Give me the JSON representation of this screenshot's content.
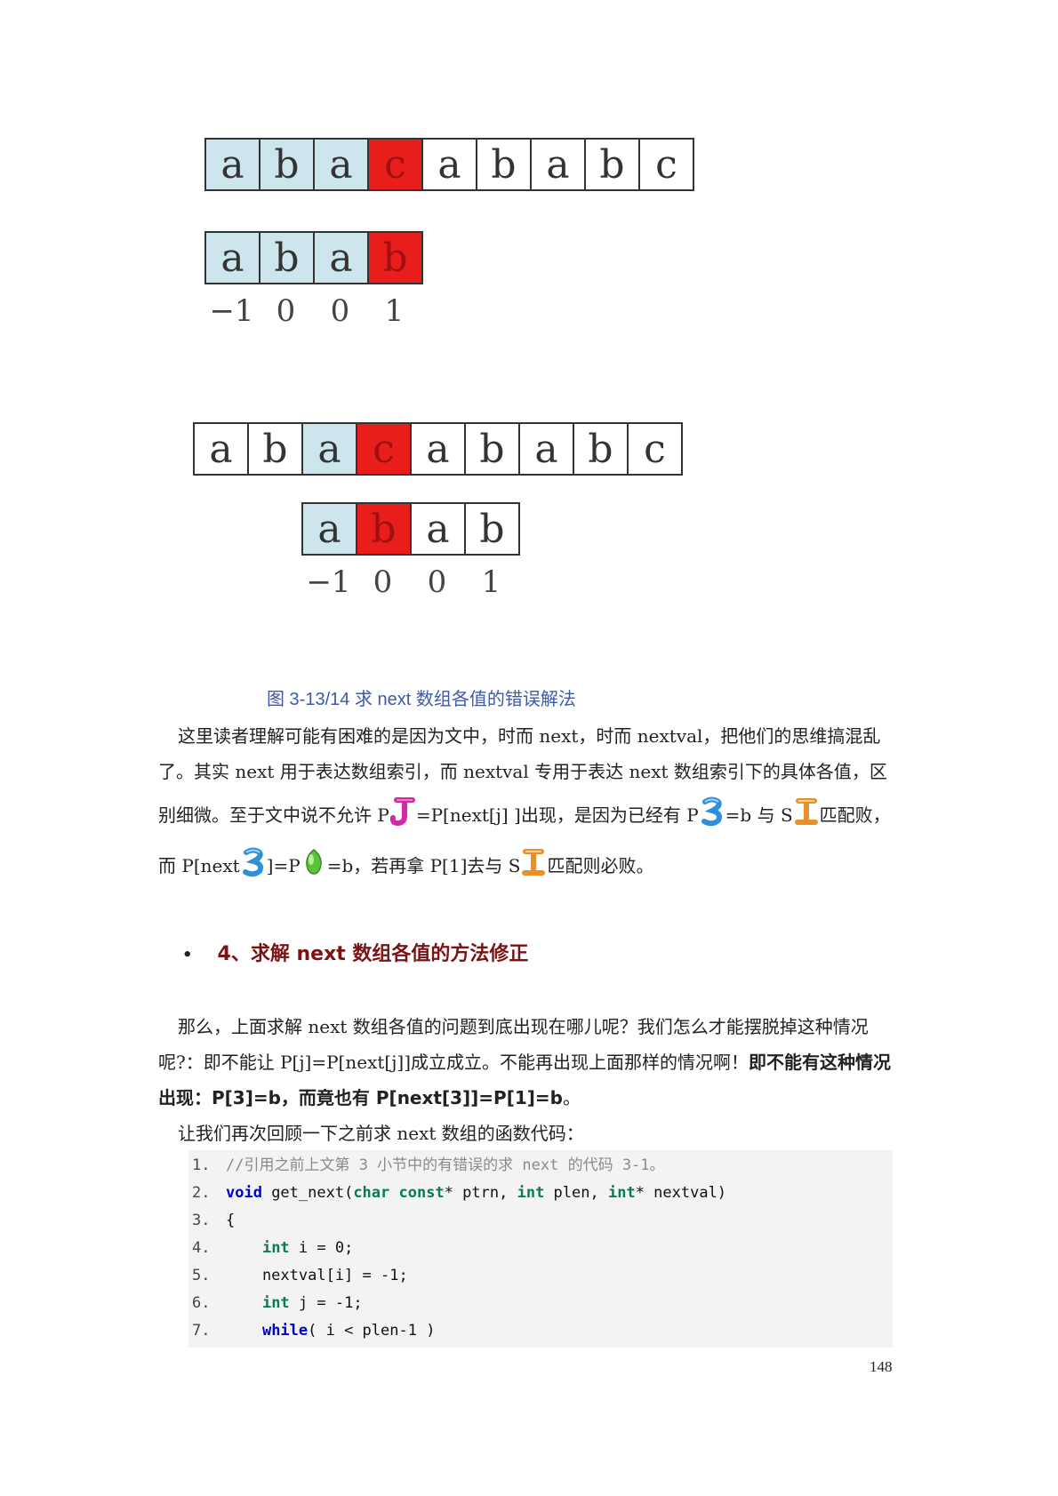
{
  "diagram1": {
    "text_cells": [
      {
        "ch": "a",
        "fill": "blue"
      },
      {
        "ch": "b",
        "fill": "blue"
      },
      {
        "ch": "a",
        "fill": "blue"
      },
      {
        "ch": "c",
        "fill": "red"
      },
      {
        "ch": "a",
        "fill": "white"
      },
      {
        "ch": "b",
        "fill": "white"
      },
      {
        "ch": "a",
        "fill": "white"
      },
      {
        "ch": "b",
        "fill": "white"
      },
      {
        "ch": "c",
        "fill": "white"
      }
    ],
    "pattern_cells": [
      {
        "ch": "a",
        "fill": "blue"
      },
      {
        "ch": "b",
        "fill": "blue"
      },
      {
        "ch": "a",
        "fill": "blue"
      },
      {
        "ch": "b",
        "fill": "red"
      }
    ],
    "next_values": [
      "−1",
      "0",
      "0",
      "1"
    ]
  },
  "diagram2": {
    "text_cells": [
      {
        "ch": "a",
        "fill": "white"
      },
      {
        "ch": "b",
        "fill": "white"
      },
      {
        "ch": "a",
        "fill": "blue"
      },
      {
        "ch": "c",
        "fill": "red"
      },
      {
        "ch": "a",
        "fill": "white"
      },
      {
        "ch": "b",
        "fill": "white"
      },
      {
        "ch": "a",
        "fill": "white"
      },
      {
        "ch": "b",
        "fill": "white"
      },
      {
        "ch": "c",
        "fill": "white"
      }
    ],
    "pattern_cells": [
      {
        "ch": "a",
        "fill": "blue"
      },
      {
        "ch": "b",
        "fill": "red"
      },
      {
        "ch": "a",
        "fill": "white"
      },
      {
        "ch": "b",
        "fill": "white"
      }
    ],
    "next_values": [
      "−1",
      "0",
      "0",
      "1"
    ]
  },
  "colors": {
    "blue": "#cde6ee",
    "red": "#ea1d1d",
    "caption": "#3e5aa8",
    "heading": "#7a1414"
  },
  "caption": "图 3-13/14  求 next 数组各值的错误解法",
  "para1": {
    "l1": "这里读者理解可能有困难的是因为文中，时而 next，时而 nextval，把他们的思维搞混乱",
    "l2": "了。其实 next 用于表达数组索引，而 nextval 专用于表达 next 数组索引下的具体各值，区",
    "l3a": "别细微。至于文中说不允许 P",
    "l3b": "=P[next[j] ]出现，是因为已经有 P",
    "l3c": "=b 与 S",
    "l3d": "匹配败，",
    "l4a": "而 P[next",
    "l4b": "]=P",
    "l4c": "=b，若再拿 P[1]去与 S",
    "l4d": "匹配则必败。"
  },
  "icons": [
    "j-icon",
    "three-icon",
    "i-icon"
  ],
  "heading": {
    "bullet": "•",
    "text": "4、求解 next 数组各值的方法修正"
  },
  "para2": {
    "l1": "那么，上面求解 next 数组各值的问题到底出现在哪儿呢？我们怎么才能摆脱掉这种情况",
    "l2a": "呢?：即不能让 P[j]=P[next[j]]成立成立。不能再出现上面那样的情况啊！",
    "l2b": "即不能有这种情况",
    "l3a": "出现：P[3]=b，而竟也有 P[next[3]]=P[1]=b",
    "l3b": "。",
    "l4": "让我们再次回顾一下之前求 next 数组的函数代码："
  },
  "code": [
    {
      "n": "1.",
      "text": "//引用之前上文第 3 小节中的有错误的求 next 的代码 3-1。"
    },
    {
      "n": "2.",
      "text": "void get_next(char const* ptrn, int plen, int* nextval)"
    },
    {
      "n": "3.",
      "text": "{"
    },
    {
      "n": "4.",
      "text": "    int i = 0;"
    },
    {
      "n": "5.",
      "text": "    nextval[i] = -1;"
    },
    {
      "n": "6.",
      "text": "    int j = -1;"
    },
    {
      "n": "7.",
      "text": "    while( i < plen-1 )"
    }
  ],
  "page_number": "148"
}
